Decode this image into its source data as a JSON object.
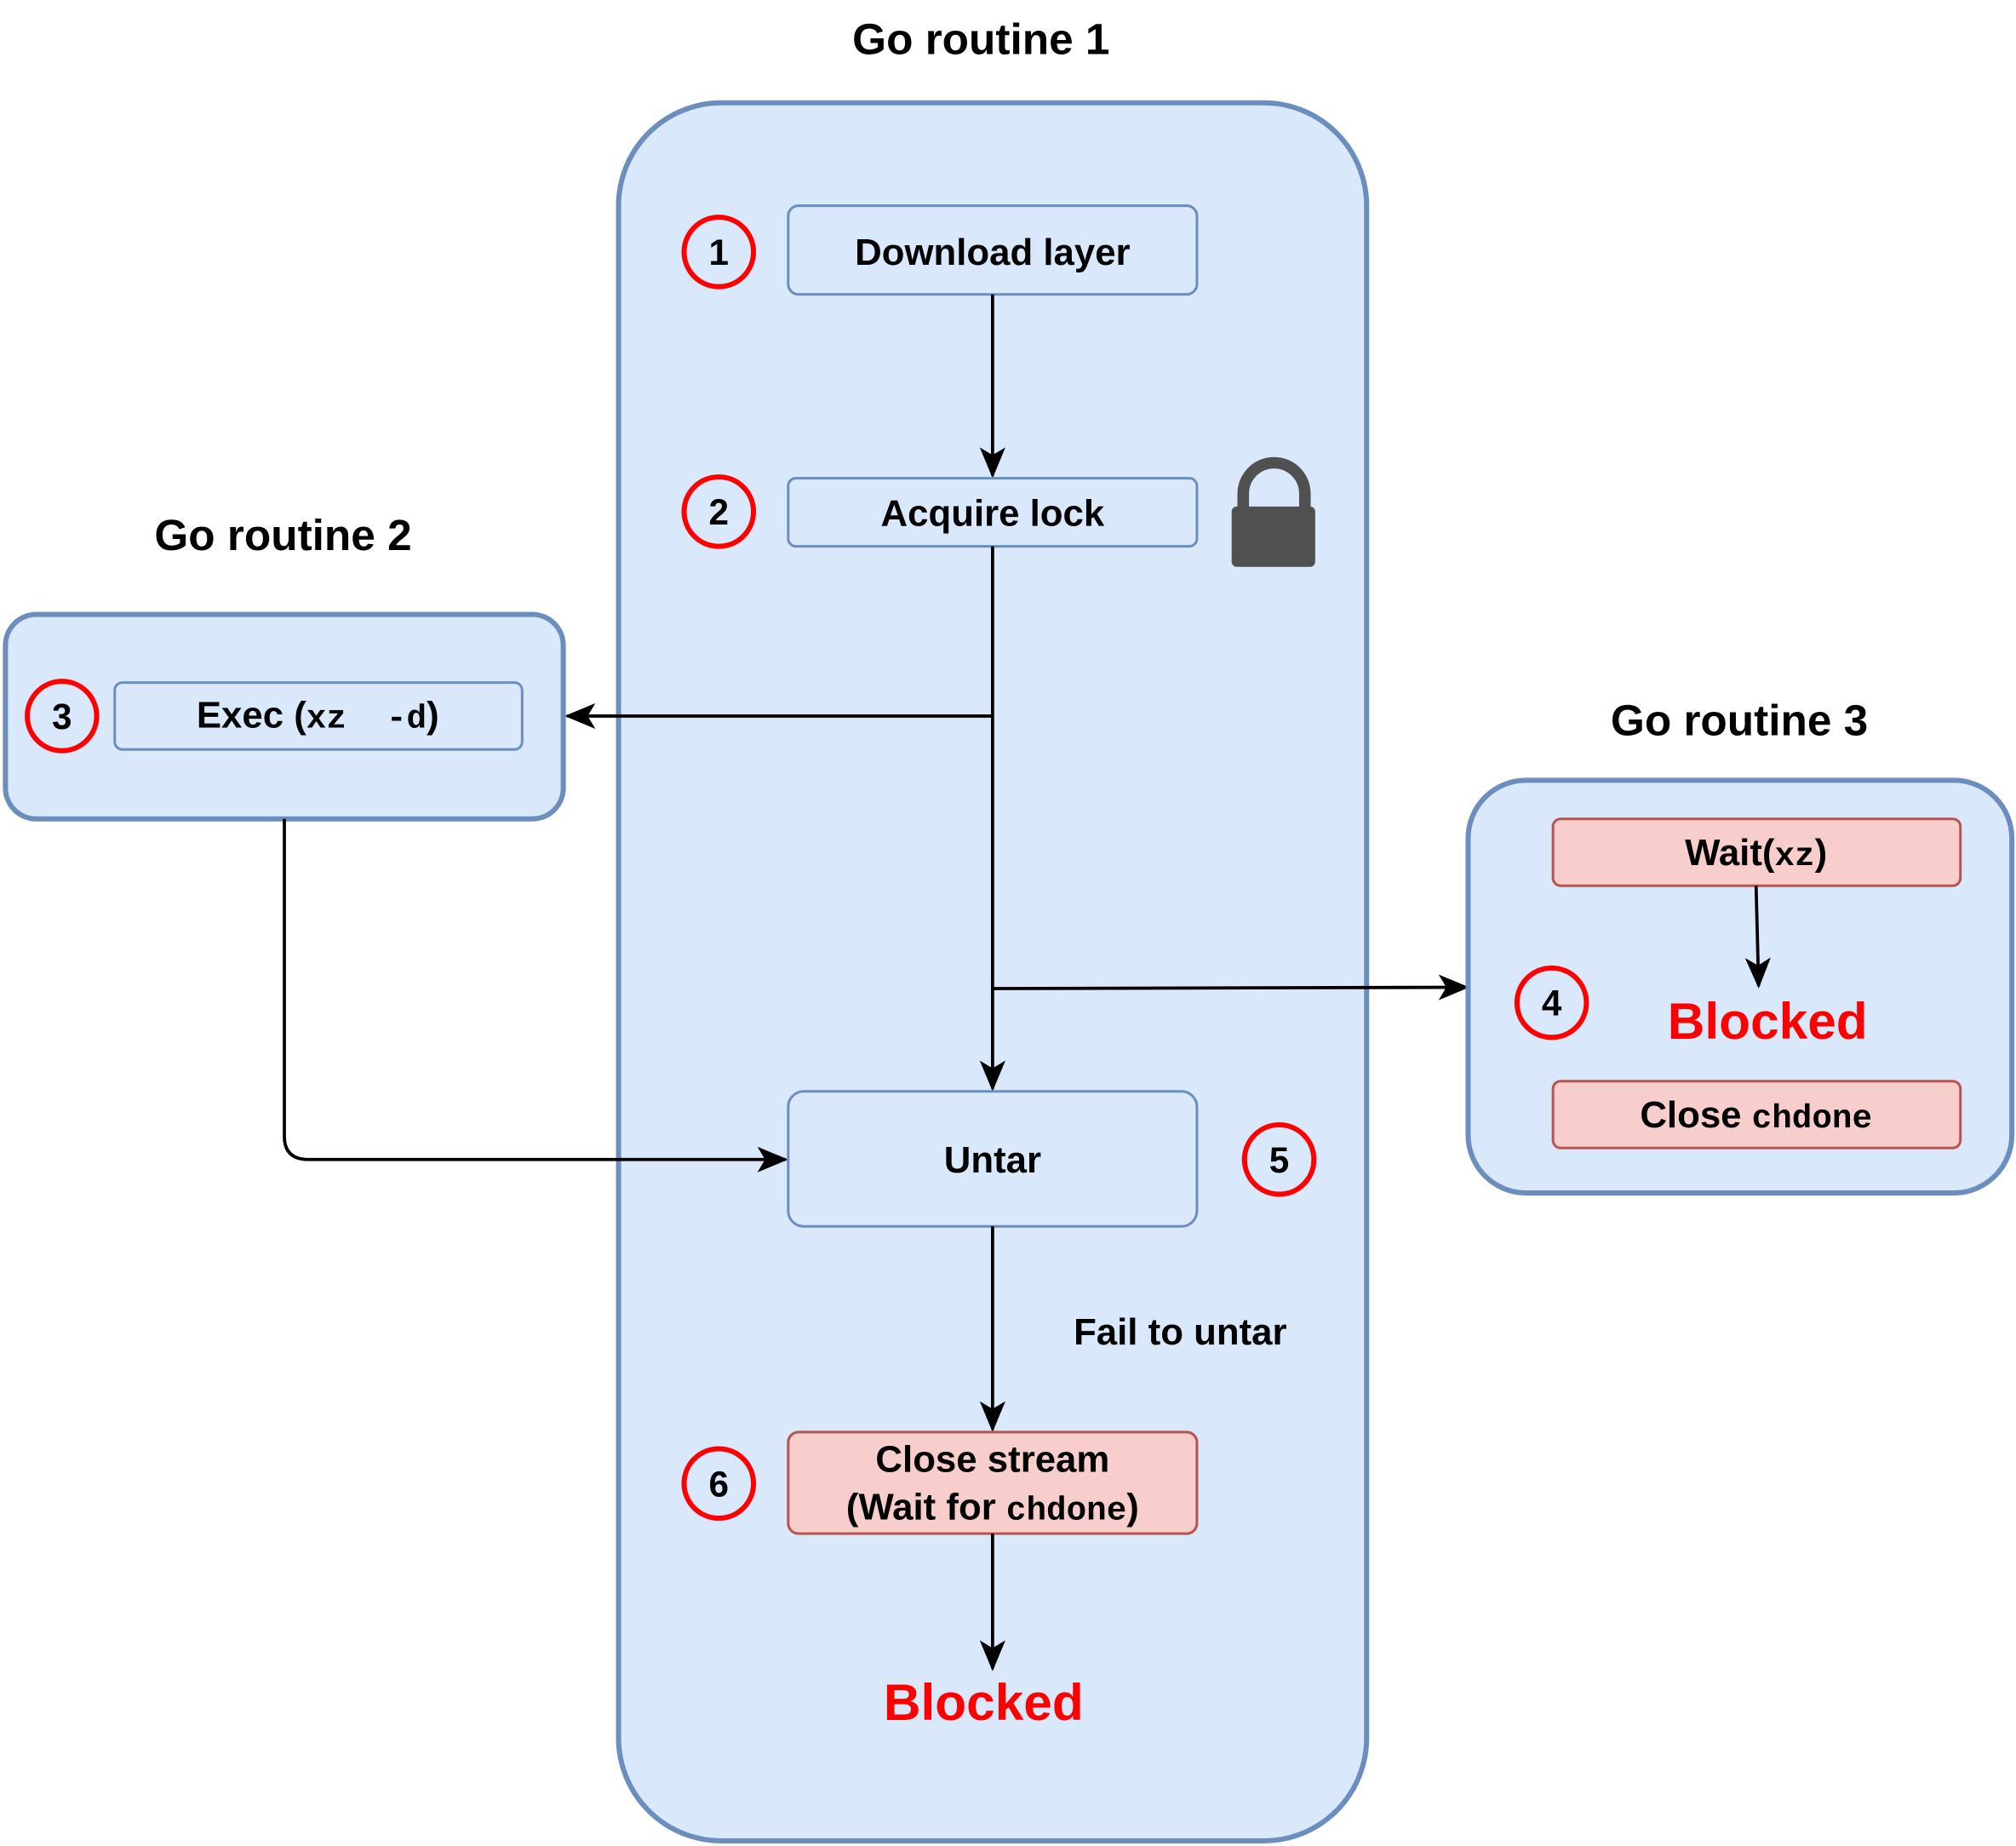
{
  "routine1": {
    "title": "Go routine 1",
    "steps": {
      "download": {
        "num": "1",
        "label": "Download layer"
      },
      "lock": {
        "num": "2",
        "label": "Acquire lock",
        "icon": "lock-icon"
      },
      "untar": {
        "num": "5",
        "label": "Untar"
      },
      "close_stream": {
        "num": "6",
        "line1": "Close stream",
        "line2_prefix": "(Wait for ",
        "line2_code": "chdone",
        "line2_suffix": ")"
      }
    },
    "fail_label": "Fail to untar",
    "blocked": "Blocked"
  },
  "routine2": {
    "title": "Go routine 2",
    "exec": {
      "num": "3",
      "prefix": "Exec (",
      "code": "xz  -d",
      "suffix": ")"
    }
  },
  "routine3": {
    "title": "Go routine 3",
    "num": "4",
    "wait": {
      "prefix": "Wait(",
      "code": "xz",
      "suffix": ")"
    },
    "blocked": "Blocked",
    "close": {
      "prefix": "Close ",
      "code": "chdone"
    }
  },
  "colors": {
    "container_fill": "#dae8fc",
    "container_stroke": "#6c8ebf",
    "blocked_fill": "#f8cecc",
    "blocked_stroke": "#b85450",
    "accent": "#ff0000"
  }
}
